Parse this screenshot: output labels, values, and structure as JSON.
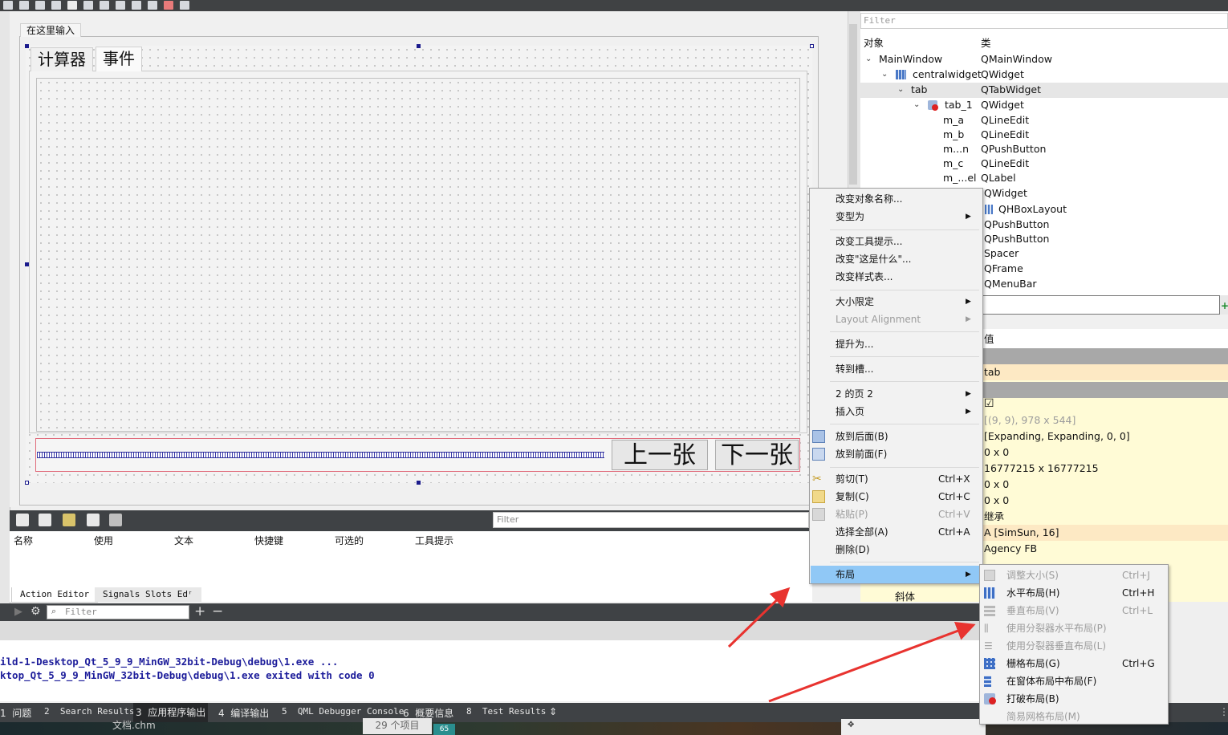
{
  "form": {
    "menu_placeholder": "在这里输入",
    "tabs": [
      "计算器",
      "事件"
    ],
    "buttons": {
      "prev": "上一张",
      "next": "下一张"
    }
  },
  "action_editor": {
    "filter_placeholder": "Filter",
    "columns": [
      "名称",
      "使用",
      "文本",
      "快捷键",
      "可选的",
      "工具提示"
    ],
    "tabs": [
      "Action Editor",
      "Signals  Slots Edʳ"
    ]
  },
  "output": {
    "filter_placeholder": "Filter",
    "lines": [
      "ild-1-Desktop_Qt_5_9_9_MinGW_32bit-Debug\\debug\\1.exe ...",
      "ktop_Qt_5_9_9_MinGW_32bit-Debug\\debug\\1.exe exited with code 0"
    ]
  },
  "status_bar": {
    "items": [
      "1  问题",
      "2  Search Results",
      "3  应用程序输出",
      "4  编译输出",
      "5  QML Debugger Console",
      "6  概要信息",
      "8  Test Results"
    ],
    "up_down": "⇕"
  },
  "taskbar": {
    "file": "文档.chm",
    "count": "29 个项目",
    "badge": "65"
  },
  "object_inspector": {
    "filter_placeholder": "Filter",
    "headers": [
      "对象",
      "类"
    ],
    "rows": [
      {
        "name": "MainWindow",
        "class": "QMainWindow"
      },
      {
        "name": "centralwidget",
        "class": "QWidget"
      },
      {
        "name": "tab",
        "class": "QTabWidget"
      },
      {
        "name": "tab_1",
        "class": "QWidget"
      },
      {
        "name": "m_a",
        "class": "QLineEdit"
      },
      {
        "name": "m_b",
        "class": "QLineEdit"
      },
      {
        "name": "m...n",
        "class": "QPushButton"
      },
      {
        "name": "m_c",
        "class": "QLineEdit"
      },
      {
        "name": "m_...el",
        "class": "QLabel"
      }
    ],
    "hidden_classes": [
      "QWidget",
      "QHBoxLayout",
      "QPushButton",
      "QPushButton",
      "Spacer",
      "QFrame",
      "QMenuBar"
    ]
  },
  "property_editor": {
    "header": "值",
    "values": [
      "tab",
      "☑",
      "[(9, 9), 978 x 544]",
      "[Expanding, Expanding, 0, 0]",
      "0 x 0",
      "16777215 x 16777215",
      "0 x 0",
      "0 x 0",
      "继承",
      "A  [SimSun, 16]",
      "Agency FB"
    ],
    "italic_label": "斜体"
  },
  "context_menu": {
    "items": [
      {
        "label": "改变对象名称...",
        "shortcut": "",
        "submenu": false,
        "disabled": false
      },
      {
        "label": "变型为",
        "shortcut": "",
        "submenu": true,
        "disabled": false
      },
      {
        "label": "改变工具提示...",
        "shortcut": "",
        "submenu": false,
        "disabled": false
      },
      {
        "label": "改变\"这是什么\"...",
        "shortcut": "",
        "submenu": false,
        "disabled": false
      },
      {
        "label": "改变样式表...",
        "shortcut": "",
        "submenu": false,
        "disabled": false
      },
      {
        "label": "大小限定",
        "shortcut": "",
        "submenu": true,
        "disabled": false
      },
      {
        "label": "Layout Alignment",
        "shortcut": "",
        "submenu": true,
        "disabled": true
      },
      {
        "label": "提升为...",
        "shortcut": "",
        "submenu": false,
        "disabled": false
      },
      {
        "label": "转到槽...",
        "shortcut": "",
        "submenu": false,
        "disabled": false
      },
      {
        "label": "2 的页 2",
        "shortcut": "",
        "submenu": true,
        "disabled": false
      },
      {
        "label": "插入页",
        "shortcut": "",
        "submenu": true,
        "disabled": false
      },
      {
        "label": "放到后面(B)",
        "shortcut": "",
        "submenu": false,
        "disabled": false
      },
      {
        "label": "放到前面(F)",
        "shortcut": "",
        "submenu": false,
        "disabled": false
      },
      {
        "label": "剪切(T)",
        "shortcut": "Ctrl+X",
        "submenu": false,
        "disabled": false
      },
      {
        "label": "复制(C)",
        "shortcut": "Ctrl+C",
        "submenu": false,
        "disabled": false
      },
      {
        "label": "粘贴(P)",
        "shortcut": "Ctrl+V",
        "submenu": false,
        "disabled": true
      },
      {
        "label": "选择全部(A)",
        "shortcut": "Ctrl+A",
        "submenu": false,
        "disabled": false
      },
      {
        "label": "删除(D)",
        "shortcut": "",
        "submenu": false,
        "disabled": false
      },
      {
        "label": "布局",
        "shortcut": "",
        "submenu": true,
        "disabled": false
      }
    ]
  },
  "layout_submenu": {
    "items": [
      {
        "label": "调整大小(S)",
        "shortcut": "Ctrl+J",
        "disabled": true
      },
      {
        "label": "水平布局(H)",
        "shortcut": "Ctrl+H",
        "disabled": false
      },
      {
        "label": "垂直布局(V)",
        "shortcut": "Ctrl+L",
        "disabled": true
      },
      {
        "label": "使用分裂器水平布局(P)",
        "shortcut": "",
        "disabled": true
      },
      {
        "label": "使用分裂器垂直布局(L)",
        "shortcut": "",
        "disabled": true
      },
      {
        "label": "栅格布局(G)",
        "shortcut": "Ctrl+G",
        "disabled": false
      },
      {
        "label": "在窗体布局中布局(F)",
        "shortcut": "",
        "disabled": false
      },
      {
        "label": "打破布局(B)",
        "shortcut": "",
        "disabled": false
      },
      {
        "label": "简易网格布局(M)",
        "shortcut": "",
        "disabled": true
      }
    ]
  },
  "colors": {
    "highlight": "#90c8f6",
    "arrow": "#e8332f",
    "dark_bar": "#3f4245",
    "property_bg": "#fffbd6"
  }
}
